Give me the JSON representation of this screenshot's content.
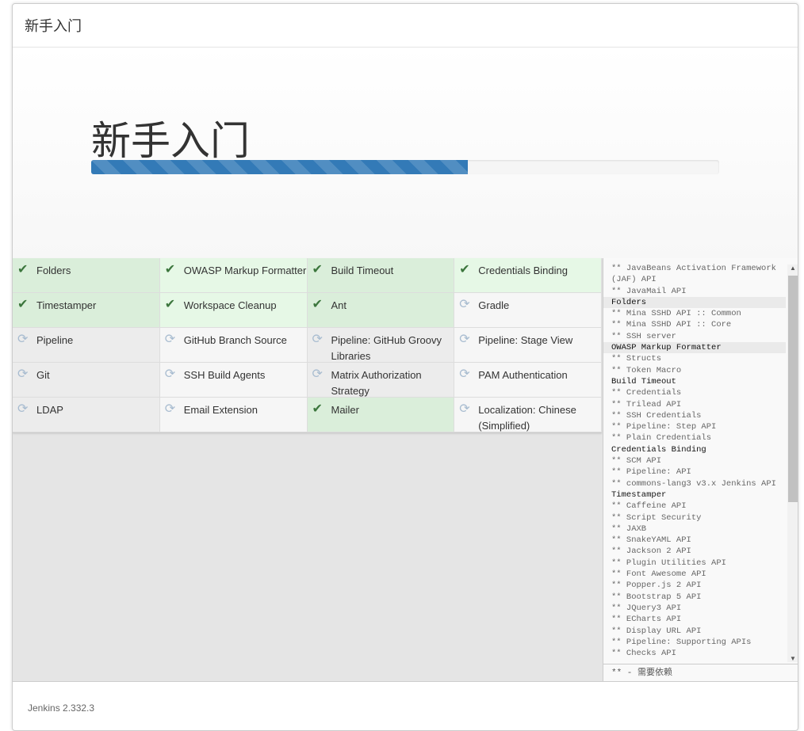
{
  "header": {
    "title": "新手入门"
  },
  "hero": {
    "title": "新手入门",
    "progress_percent": 60,
    "progress_color": "#337ab7"
  },
  "plugins": [
    {
      "label": "Folders",
      "status": "success"
    },
    {
      "label": "OWASP Markup Formatter",
      "status": "success"
    },
    {
      "label": "Build Timeout",
      "status": "success"
    },
    {
      "label": "Credentials Binding",
      "status": "success"
    },
    {
      "label": "Timestamper",
      "status": "success"
    },
    {
      "label": "Workspace Cleanup",
      "status": "success"
    },
    {
      "label": "Ant",
      "status": "success"
    },
    {
      "label": "Gradle",
      "status": "installing"
    },
    {
      "label": "Pipeline",
      "status": "installing"
    },
    {
      "label": "GitHub Branch Source",
      "status": "installing"
    },
    {
      "label": "Pipeline: GitHub Groovy Libraries",
      "status": "installing"
    },
    {
      "label": "Pipeline: Stage View",
      "status": "installing"
    },
    {
      "label": "Git",
      "status": "installing"
    },
    {
      "label": "SSH Build Agents",
      "status": "installing"
    },
    {
      "label": "Matrix Authorization Strategy",
      "status": "installing"
    },
    {
      "label": "PAM Authentication",
      "status": "installing"
    },
    {
      "label": "LDAP",
      "status": "installing"
    },
    {
      "label": "Email Extension",
      "status": "installing"
    },
    {
      "label": "Mailer",
      "status": "success"
    },
    {
      "label": "Localization: Chinese (Simplified)",
      "status": "installing"
    }
  ],
  "log": [
    {
      "t": "** JavaBeans Activation Framework (JAF) API",
      "k": "dep"
    },
    {
      "t": "** JavaMail API",
      "k": "dep"
    },
    {
      "t": "Folders",
      "k": "plugin",
      "hl": true
    },
    {
      "t": "** Mina SSHD API :: Common",
      "k": "dep"
    },
    {
      "t": "** Mina SSHD API :: Core",
      "k": "dep"
    },
    {
      "t": "** SSH server",
      "k": "dep"
    },
    {
      "t": "OWASP Markup Formatter",
      "k": "plugin",
      "hl": true
    },
    {
      "t": "** Structs",
      "k": "dep"
    },
    {
      "t": "** Token Macro",
      "k": "dep"
    },
    {
      "t": "Build Timeout",
      "k": "plugin"
    },
    {
      "t": "** Credentials",
      "k": "dep"
    },
    {
      "t": "** Trilead API",
      "k": "dep"
    },
    {
      "t": "** SSH Credentials",
      "k": "dep"
    },
    {
      "t": "** Pipeline: Step API",
      "k": "dep"
    },
    {
      "t": "** Plain Credentials",
      "k": "dep"
    },
    {
      "t": "Credentials Binding",
      "k": "plugin"
    },
    {
      "t": "** SCM API",
      "k": "dep"
    },
    {
      "t": "** Pipeline: API",
      "k": "dep"
    },
    {
      "t": "** commons-lang3 v3.x Jenkins API",
      "k": "dep"
    },
    {
      "t": "Timestamper",
      "k": "plugin"
    },
    {
      "t": "** Caffeine API",
      "k": "dep"
    },
    {
      "t": "** Script Security",
      "k": "dep"
    },
    {
      "t": "** JAXB",
      "k": "dep"
    },
    {
      "t": "** SnakeYAML API",
      "k": "dep"
    },
    {
      "t": "** Jackson 2 API",
      "k": "dep"
    },
    {
      "t": "** Plugin Utilities API",
      "k": "dep"
    },
    {
      "t": "** Font Awesome API",
      "k": "dep"
    },
    {
      "t": "** Popper.js 2 API",
      "k": "dep"
    },
    {
      "t": "** Bootstrap 5 API",
      "k": "dep"
    },
    {
      "t": "** JQuery3 API",
      "k": "dep"
    },
    {
      "t": "** ECharts API",
      "k": "dep"
    },
    {
      "t": "** Display URL API",
      "k": "dep"
    },
    {
      "t": "** Pipeline: Supporting APIs",
      "k": "dep"
    },
    {
      "t": "** Checks API",
      "k": "dep"
    }
  ],
  "legend": "** - 需要依赖",
  "footer": {
    "version": "Jenkins 2.332.3"
  }
}
